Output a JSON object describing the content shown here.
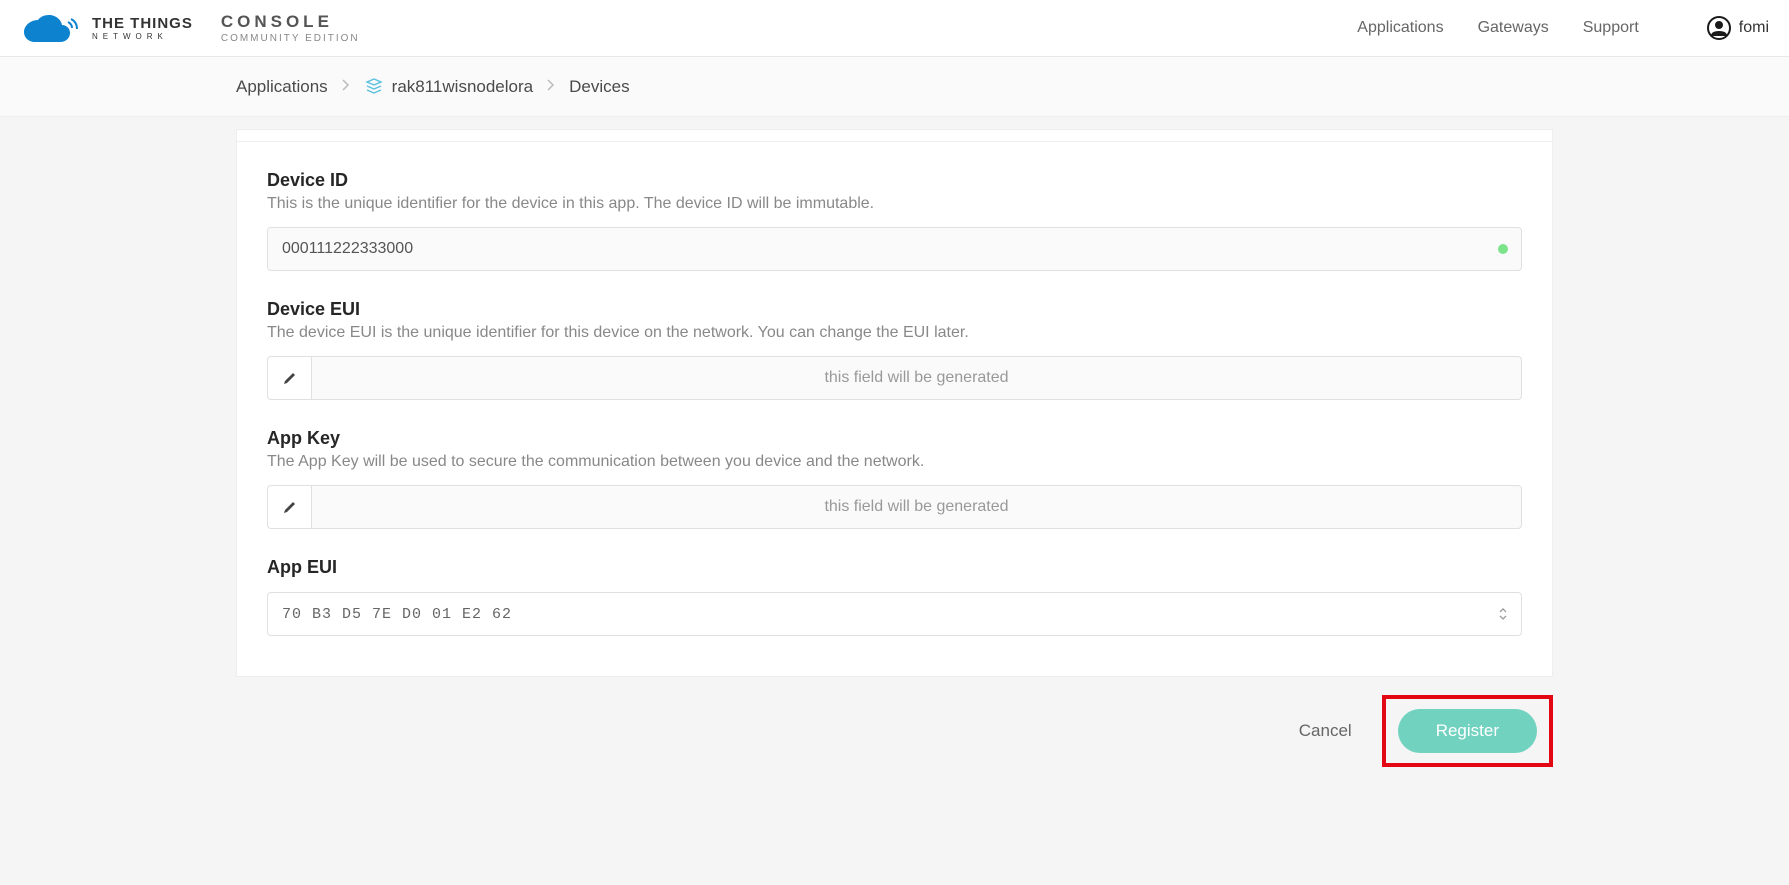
{
  "header": {
    "logo_line1": "THE THINGS",
    "logo_line2": "NETWORK",
    "console_line1": "CONSOLE",
    "console_line2": "COMMUNITY EDITION",
    "nav": {
      "applications": "Applications",
      "gateways": "Gateways",
      "support": "Support"
    },
    "user_name": "fomi"
  },
  "breadcrumb": {
    "root": "Applications",
    "app": "rak811wisnodelora",
    "leaf": "Devices"
  },
  "form": {
    "device_id": {
      "label": "Device ID",
      "desc": "This is the unique identifier for the device in this app. The device ID will be immutable.",
      "value": "000111222333000"
    },
    "device_eui": {
      "label": "Device EUI",
      "desc": "The device EUI is the unique identifier for this device on the network. You can change the EUI later.",
      "placeholder": "this field will be generated"
    },
    "app_key": {
      "label": "App Key",
      "desc": "The App Key will be used to secure the communication between you device and the network.",
      "placeholder": "this field will be generated"
    },
    "app_eui": {
      "label": "App EUI",
      "value": "70 B3 D5 7E D0 01 E2 62"
    }
  },
  "actions": {
    "cancel": "Cancel",
    "register": "Register"
  }
}
